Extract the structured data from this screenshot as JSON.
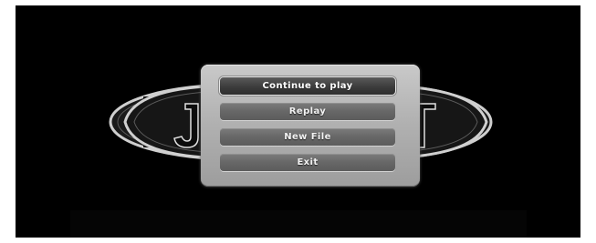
{
  "menu": {
    "items": [
      {
        "label": "Continue to play",
        "selected": true
      },
      {
        "label": "Replay",
        "selected": false
      },
      {
        "label": "New File",
        "selected": false
      },
      {
        "label": "Exit",
        "selected": false
      }
    ]
  },
  "background": {
    "logo_icon": "oval-emblem-logo",
    "color": "#000000"
  }
}
